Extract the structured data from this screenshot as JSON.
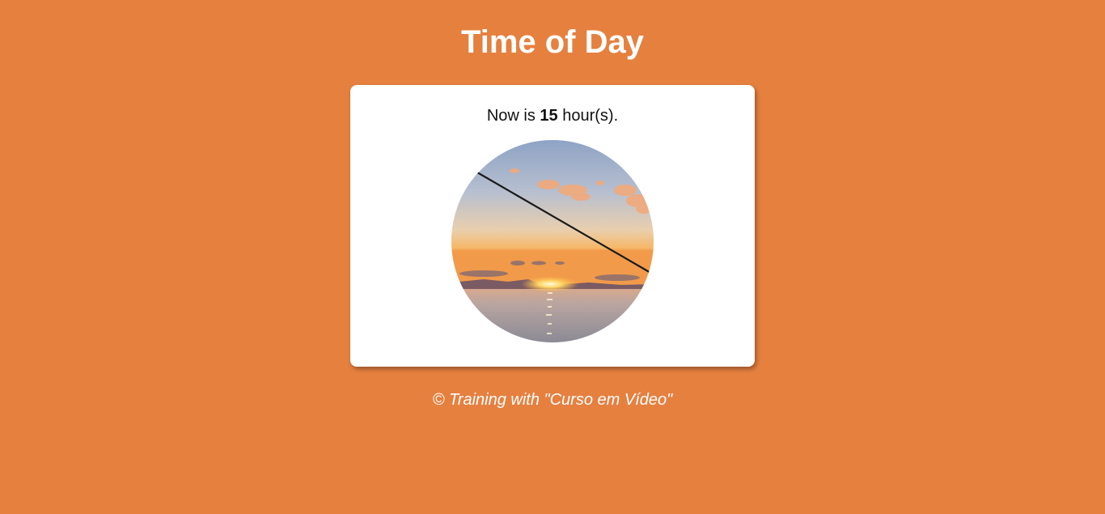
{
  "page": {
    "title": "Time of Day",
    "background_color": "#e6803f"
  },
  "card": {
    "text_prefix": "Now is",
    "hour": "15",
    "text_suffix": "hour(s).",
    "image_subject": "sunset-over-sea-with-fishing-rod"
  },
  "footer": {
    "text": "© Training with \"Curso em Vídeo\""
  }
}
